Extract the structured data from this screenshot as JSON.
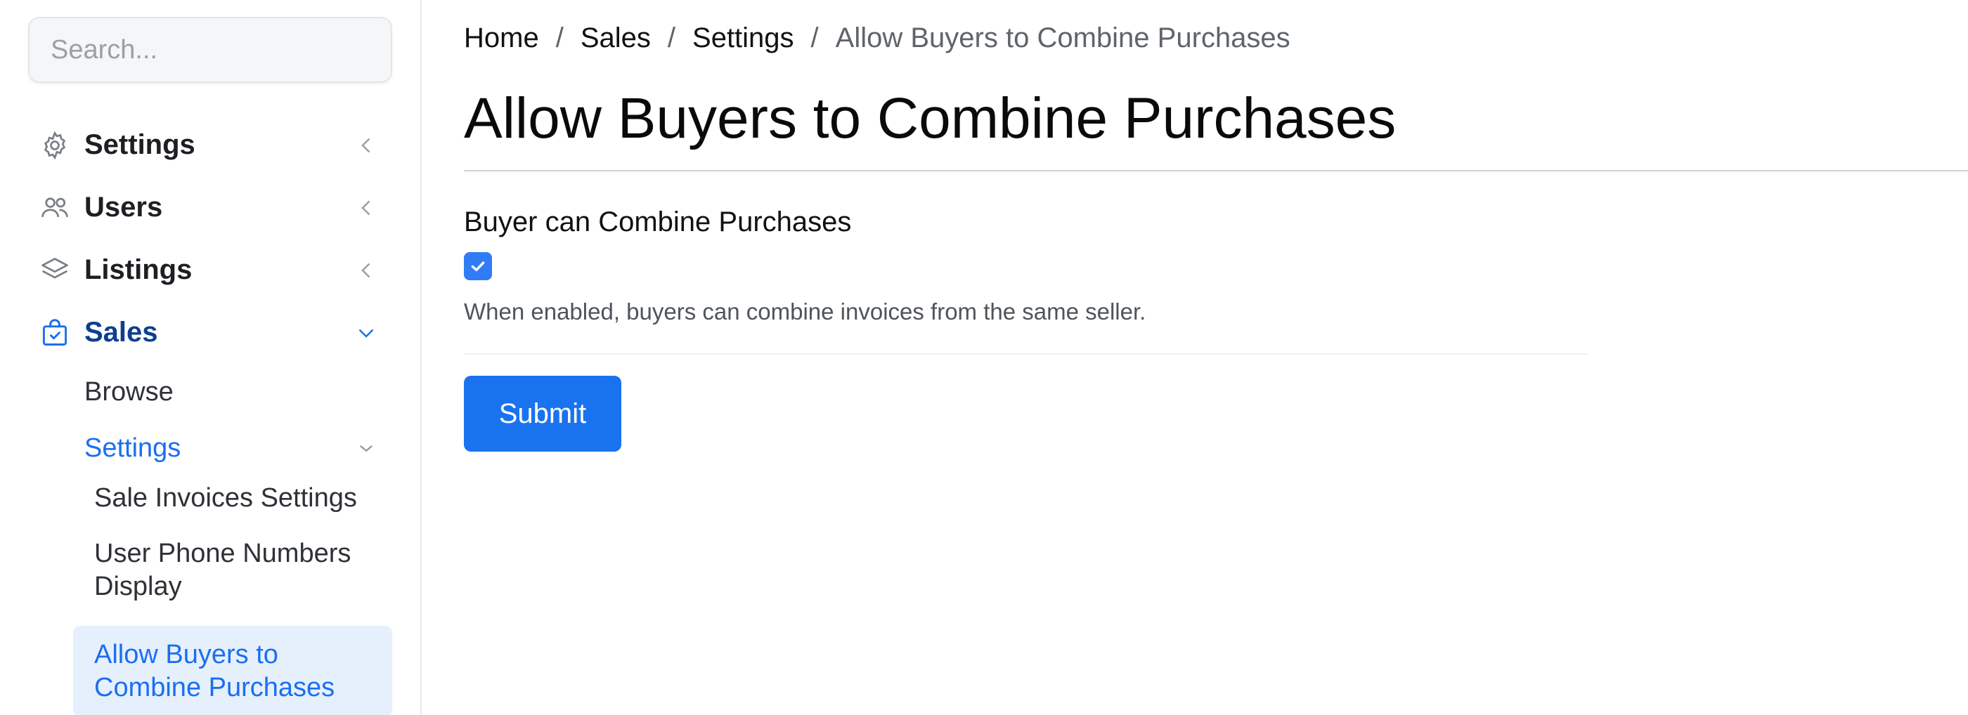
{
  "search": {
    "placeholder": "Search..."
  },
  "sidebar": {
    "items": [
      {
        "label": "Settings"
      },
      {
        "label": "Users"
      },
      {
        "label": "Listings"
      },
      {
        "label": "Sales"
      }
    ],
    "sales_children": {
      "browse": "Browse",
      "settings": "Settings",
      "settings_children": [
        "Sale Invoices Settings",
        "User Phone Numbers Display",
        "Allow Buyers to Combine Purchases"
      ]
    }
  },
  "breadcrumb": [
    "Home",
    "Sales",
    "Settings",
    "Allow Buyers to Combine Purchases"
  ],
  "breadcrumb_separator": "/",
  "page": {
    "title": "Allow Buyers to Combine Purchases",
    "field_label": "Buyer can Combine Purchases",
    "checkbox_checked": true,
    "help_text": "When enabled, buyers can combine invoices from the same seller.",
    "submit_label": "Submit"
  },
  "colors": {
    "accent": "#1a73ee",
    "active_bg": "#e6f0fd",
    "active_text": "#1a6ff0"
  }
}
